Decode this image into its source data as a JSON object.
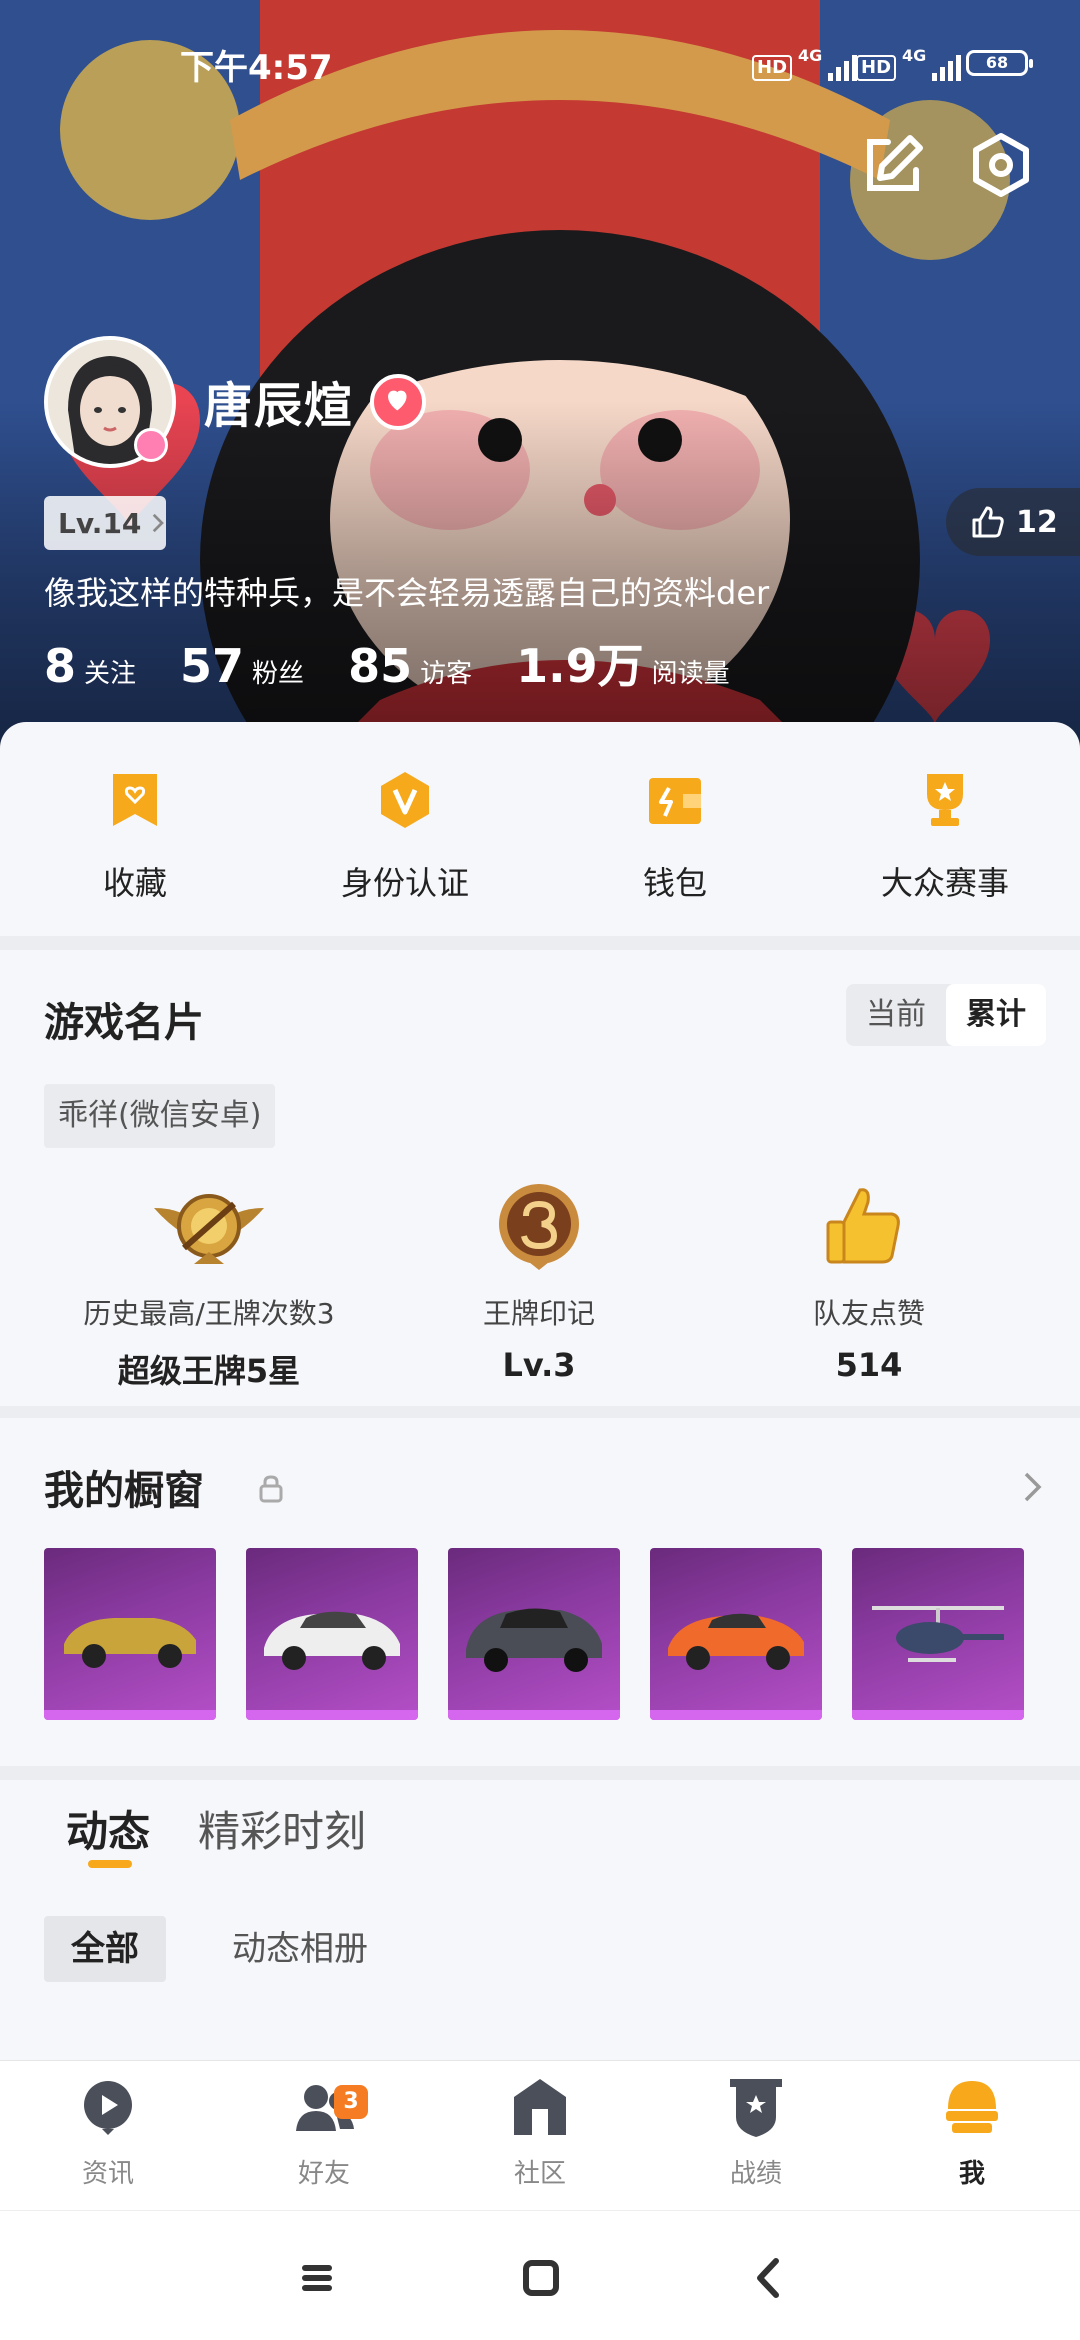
{
  "status_bar": {
    "time": "下午4:57",
    "hd1": "HD",
    "net1": "4G",
    "hd2": "HD",
    "net2": "4G",
    "battery": "68"
  },
  "profile": {
    "name": "唐辰煊",
    "level": "Lv.14",
    "likes": "12",
    "bio": "像我这样的特种兵，是不会轻易透露自己的资料der",
    "stats": [
      {
        "value": "8",
        "label": "关注"
      },
      {
        "value": "57",
        "label": "粉丝"
      },
      {
        "value": "85",
        "label": "访客"
      },
      {
        "value": "1.9万",
        "label": "阅读量"
      }
    ]
  },
  "quick_actions": [
    {
      "label": "收藏",
      "icon": "bookmark-heart-icon"
    },
    {
      "label": "身份认证",
      "icon": "verify-v-icon"
    },
    {
      "label": "钱包",
      "icon": "wallet-icon"
    },
    {
      "label": "大众赛事",
      "icon": "trophy-icon"
    }
  ],
  "game_card": {
    "title": "游戏名片",
    "toggle": {
      "current": "当前",
      "total": "累计",
      "selected": "累计"
    },
    "account_tag": "乖徉(微信安卓)",
    "stats": [
      {
        "caption": "历史最高/王牌次数3",
        "value": "超级王牌5星",
        "icon": "ace-wings-icon"
      },
      {
        "caption": "王牌印记",
        "value": "Lv.3",
        "icon": "ace-mark-3-icon"
      },
      {
        "caption": "队友点赞",
        "value": "514",
        "icon": "thumbs-up-icon"
      }
    ]
  },
  "showcase": {
    "title": "我的橱窗",
    "items": [
      {
        "icon": "gold-sports-car-icon",
        "color": "#c9a43a"
      },
      {
        "icon": "white-sedan-icon",
        "color": "#eeeeee"
      },
      {
        "icon": "dark-gray-suv-icon",
        "color": "#4a4d55"
      },
      {
        "icon": "orange-sports-car-icon",
        "color": "#f06a2b"
      },
      {
        "icon": "helicopter-icon",
        "color": "#3b4a6a"
      }
    ]
  },
  "feed": {
    "tabs": [
      "动态",
      "精彩时刻"
    ],
    "active_tab": "动态",
    "subtabs": [
      "全部",
      "动态相册"
    ],
    "active_subtab": "全部"
  },
  "bottom_nav": [
    {
      "label": "资讯",
      "icon": "news-play-icon"
    },
    {
      "label": "好友",
      "icon": "friends-icon",
      "badge": "3"
    },
    {
      "label": "社区",
      "icon": "community-house-icon"
    },
    {
      "label": "战绩",
      "icon": "record-shield-icon"
    },
    {
      "label": "我",
      "icon": "helmet-me-icon",
      "active": true
    }
  ],
  "colors": {
    "accent": "#f7a91b",
    "badge": "#f57c22",
    "showcase_purple": "#b54fc8",
    "heart": "#ff5b6e"
  }
}
